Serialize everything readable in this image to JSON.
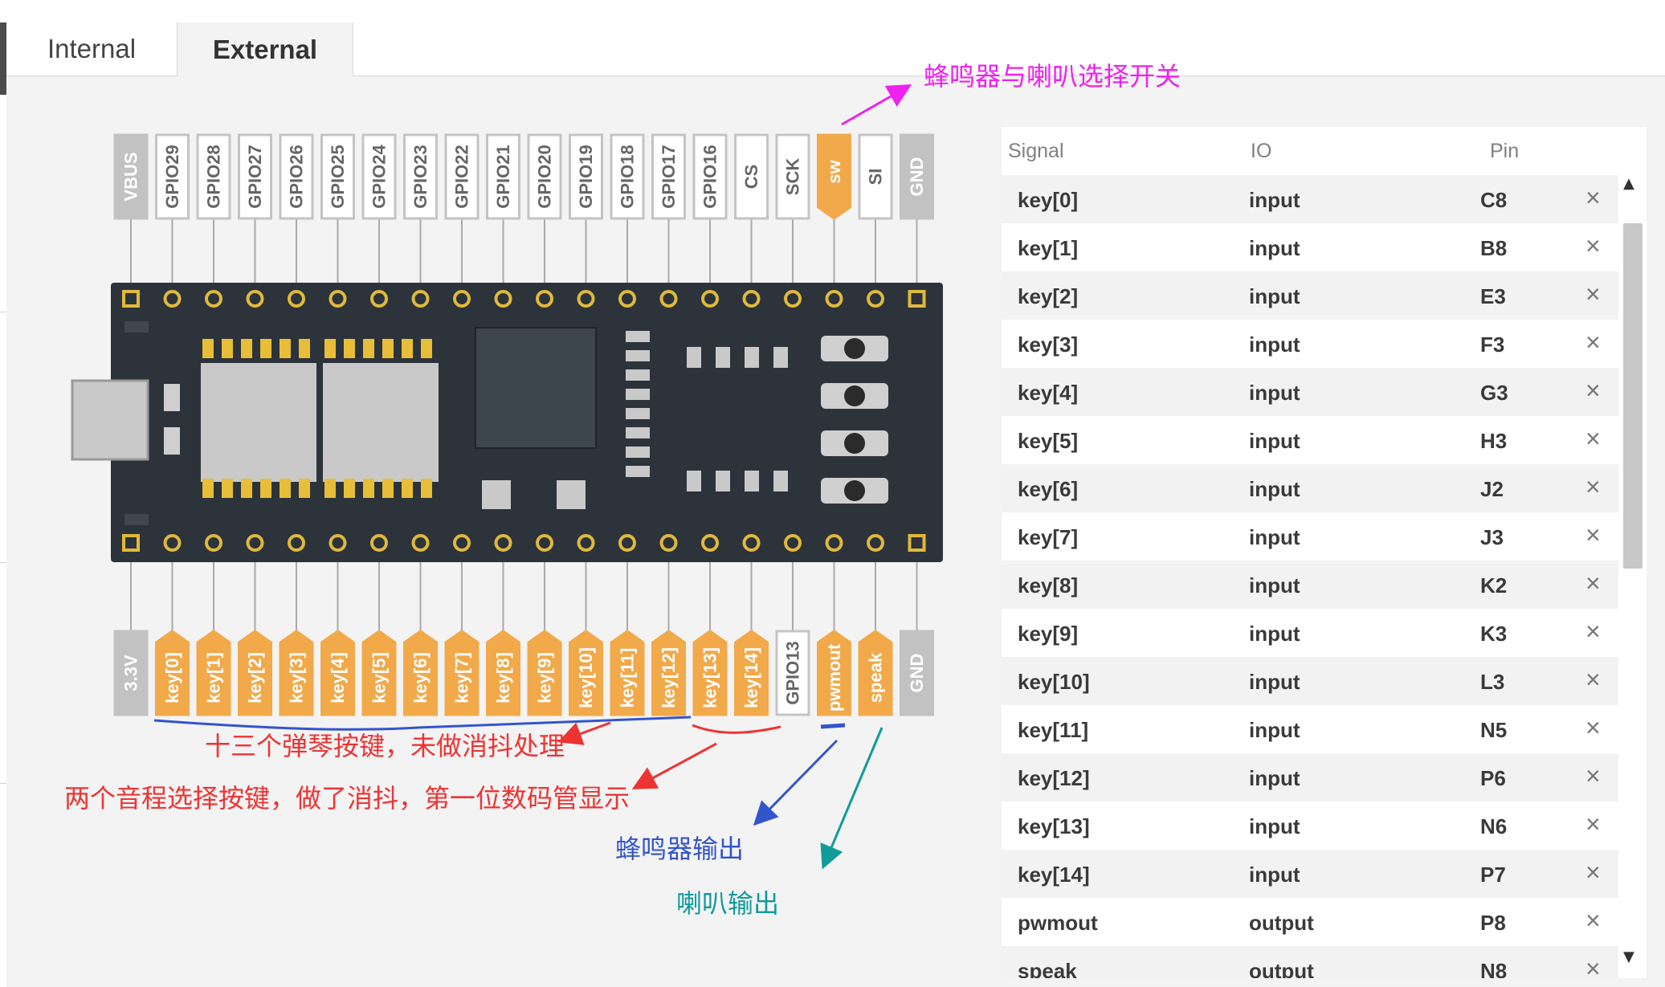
{
  "tabs": [
    {
      "label": "Internal",
      "active": false
    },
    {
      "label": "External",
      "active": true
    }
  ],
  "board": {
    "top_pins": [
      "VBUS",
      "GPIO29",
      "GPIO28",
      "GPIO27",
      "GPIO26",
      "GPIO25",
      "GPIO24",
      "GPIO23",
      "GPIO22",
      "GPIO21",
      "GPIO20",
      "GPIO19",
      "GPIO18",
      "GPIO17",
      "GPIO16",
      "CS",
      "SCK",
      "sw",
      "SI",
      "GND"
    ],
    "top_pin_states": [
      "power",
      "unused",
      "unused",
      "unused",
      "unused",
      "unused",
      "unused",
      "unused",
      "unused",
      "unused",
      "unused",
      "unused",
      "unused",
      "unused",
      "unused",
      "unused",
      "unused",
      "assigned",
      "unused",
      "power"
    ],
    "bottom_pins": [
      "3.3V",
      "key[0]",
      "key[1]",
      "key[2]",
      "key[3]",
      "key[4]",
      "key[5]",
      "key[6]",
      "key[7]",
      "key[8]",
      "key[9]",
      "key[10]",
      "key[11]",
      "key[12]",
      "key[13]",
      "key[14]",
      "GPIO13",
      "pwmout",
      "speak",
      "GND"
    ],
    "bottom_pin_states": [
      "power",
      "assigned",
      "assigned",
      "assigned",
      "assigned",
      "assigned",
      "assigned",
      "assigned",
      "assigned",
      "assigned",
      "assigned",
      "assigned",
      "assigned",
      "assigned",
      "assigned",
      "assigned",
      "unused",
      "assigned",
      "assigned",
      "power"
    ]
  },
  "colors": {
    "assigned": "#f1a94a",
    "unused_border": "#c4c4c4",
    "power": "#c2c2c2",
    "pcb": "#2c333b",
    "magenta": "#ee22ee",
    "red": "#ee3333",
    "blue": "#3355cc",
    "teal": "#119b9b"
  },
  "table": {
    "headers": {
      "signal": "Signal",
      "io": "IO",
      "pin": "Pin"
    },
    "rows": [
      {
        "signal": "key[0]",
        "io": "input",
        "pin": "C8"
      },
      {
        "signal": "key[1]",
        "io": "input",
        "pin": "B8"
      },
      {
        "signal": "key[2]",
        "io": "input",
        "pin": "E3"
      },
      {
        "signal": "key[3]",
        "io": "input",
        "pin": "F3"
      },
      {
        "signal": "key[4]",
        "io": "input",
        "pin": "G3"
      },
      {
        "signal": "key[5]",
        "io": "input",
        "pin": "H3"
      },
      {
        "signal": "key[6]",
        "io": "input",
        "pin": "J2"
      },
      {
        "signal": "key[7]",
        "io": "input",
        "pin": "J3"
      },
      {
        "signal": "key[8]",
        "io": "input",
        "pin": "K2"
      },
      {
        "signal": "key[9]",
        "io": "input",
        "pin": "K3"
      },
      {
        "signal": "key[10]",
        "io": "input",
        "pin": "L3"
      },
      {
        "signal": "key[11]",
        "io": "input",
        "pin": "N5"
      },
      {
        "signal": "key[12]",
        "io": "input",
        "pin": "P6"
      },
      {
        "signal": "key[13]",
        "io": "input",
        "pin": "N6"
      },
      {
        "signal": "key[14]",
        "io": "input",
        "pin": "P7"
      },
      {
        "signal": "pwmout",
        "io": "output",
        "pin": "P8"
      },
      {
        "signal": "speak",
        "io": "output",
        "pin": "N8"
      }
    ],
    "remove_icon": "close-icon",
    "scroll_up": "▲",
    "scroll_down": "▼"
  },
  "annotations": {
    "switch": "蜂鸣器与喇叭选择开关",
    "keys13": "十三个弹琴按键，未做消抖处理",
    "keys2": "两个音程选择按键，做了消抖，第一位数码管显示",
    "buzzer": "蜂鸣器输出",
    "speaker": "喇叭输出"
  }
}
